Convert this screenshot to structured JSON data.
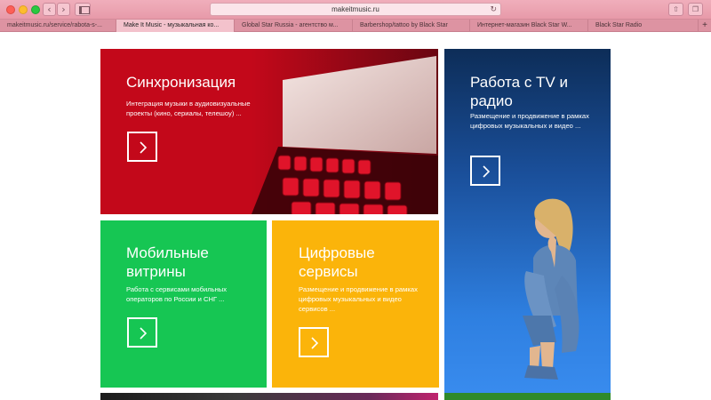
{
  "browser": {
    "address": "makeitmusic.ru",
    "tabs": [
      {
        "label": "makeitmusic.ru/service/rabota-s-..."
      },
      {
        "label": "Make It Music - музыкальная ко..."
      },
      {
        "label": "Global Star Russia - агентство м..."
      },
      {
        "label": "Barbershop/tattoo by Black Star"
      },
      {
        "label": "Интернет-магазин Black Star W..."
      },
      {
        "label": "Black Star Radio"
      }
    ]
  },
  "tiles": {
    "sync": {
      "title": "Синхронизация",
      "text": "Интеграция музыки в аудиовизуальные проекты (кино, сериалы, телешоу) ..."
    },
    "tv": {
      "title": "Работа с TV и радио",
      "text": "Размещение и продвижение в рамках цифровых музыкальных и видео ..."
    },
    "mobile": {
      "title": "Мобильные витрины",
      "text": "Работа с сервисами мобильных операторов по России и СНГ ..."
    },
    "digital": {
      "title": "Цифровые сервисы",
      "text": "Размещение и продвижение в рамках цифровых музыкальных и видео сервисов ..."
    }
  },
  "colors": {
    "sync": "#c3081a",
    "tv": "#1a4f9a",
    "mobile": "#16c653",
    "digital": "#fbb40a"
  }
}
